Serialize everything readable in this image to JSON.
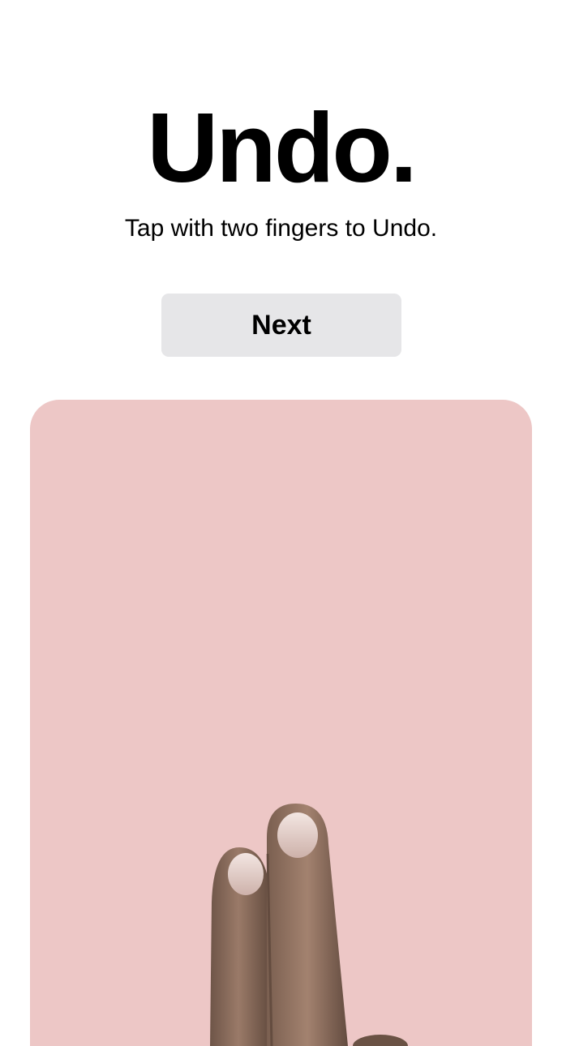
{
  "onboarding": {
    "title": "Undo.",
    "instruction": "Tap with two fingers to Undo.",
    "next_label": "Next"
  },
  "demo": {
    "illustration": "two-finger-tap-hand-icon",
    "background_color": "#edc7c6"
  },
  "colors": {
    "button_background": "#e6e6e8",
    "text": "#000000",
    "page_background": "#ffffff"
  }
}
